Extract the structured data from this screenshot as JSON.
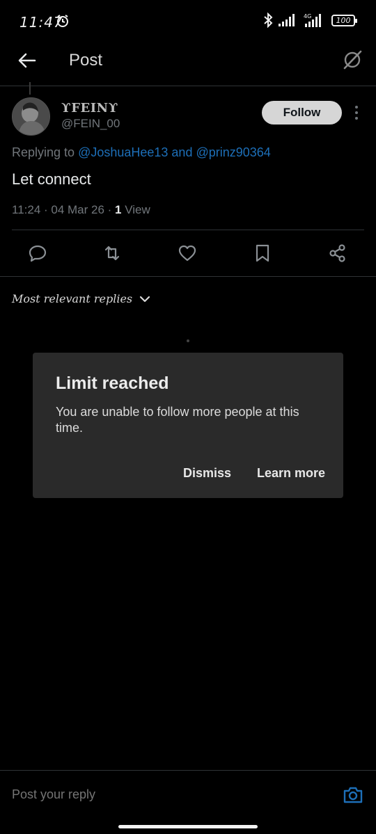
{
  "status_bar": {
    "time": "11:47",
    "network": "4G",
    "battery": "100"
  },
  "header": {
    "title": "Post"
  },
  "post": {
    "display_name": "FEIN",
    "handle": "@FEIN_00",
    "follow_label": "Follow",
    "replying_prefix": "Replying to ",
    "reply_user_1": "@JoshuaHee13",
    "reply_and": " and ",
    "reply_user_2": "@prinz90364",
    "text": "Let connect",
    "timestamp": "11:24 · 04 Mar 26 · ",
    "views_count": "1",
    "views_label": " View"
  },
  "sort": {
    "label": "Most relevant replies"
  },
  "dialog": {
    "title": "Limit reached",
    "body": "You are unable to follow more people at this time.",
    "dismiss_label": "Dismiss",
    "learn_more_label": "Learn more"
  },
  "reply_bar": {
    "placeholder": "Post your reply"
  },
  "colors": {
    "link": "#1d6fb8",
    "background": "#000000",
    "dialog": "#2a2a2a",
    "follow_bg": "#d6d6d6"
  }
}
